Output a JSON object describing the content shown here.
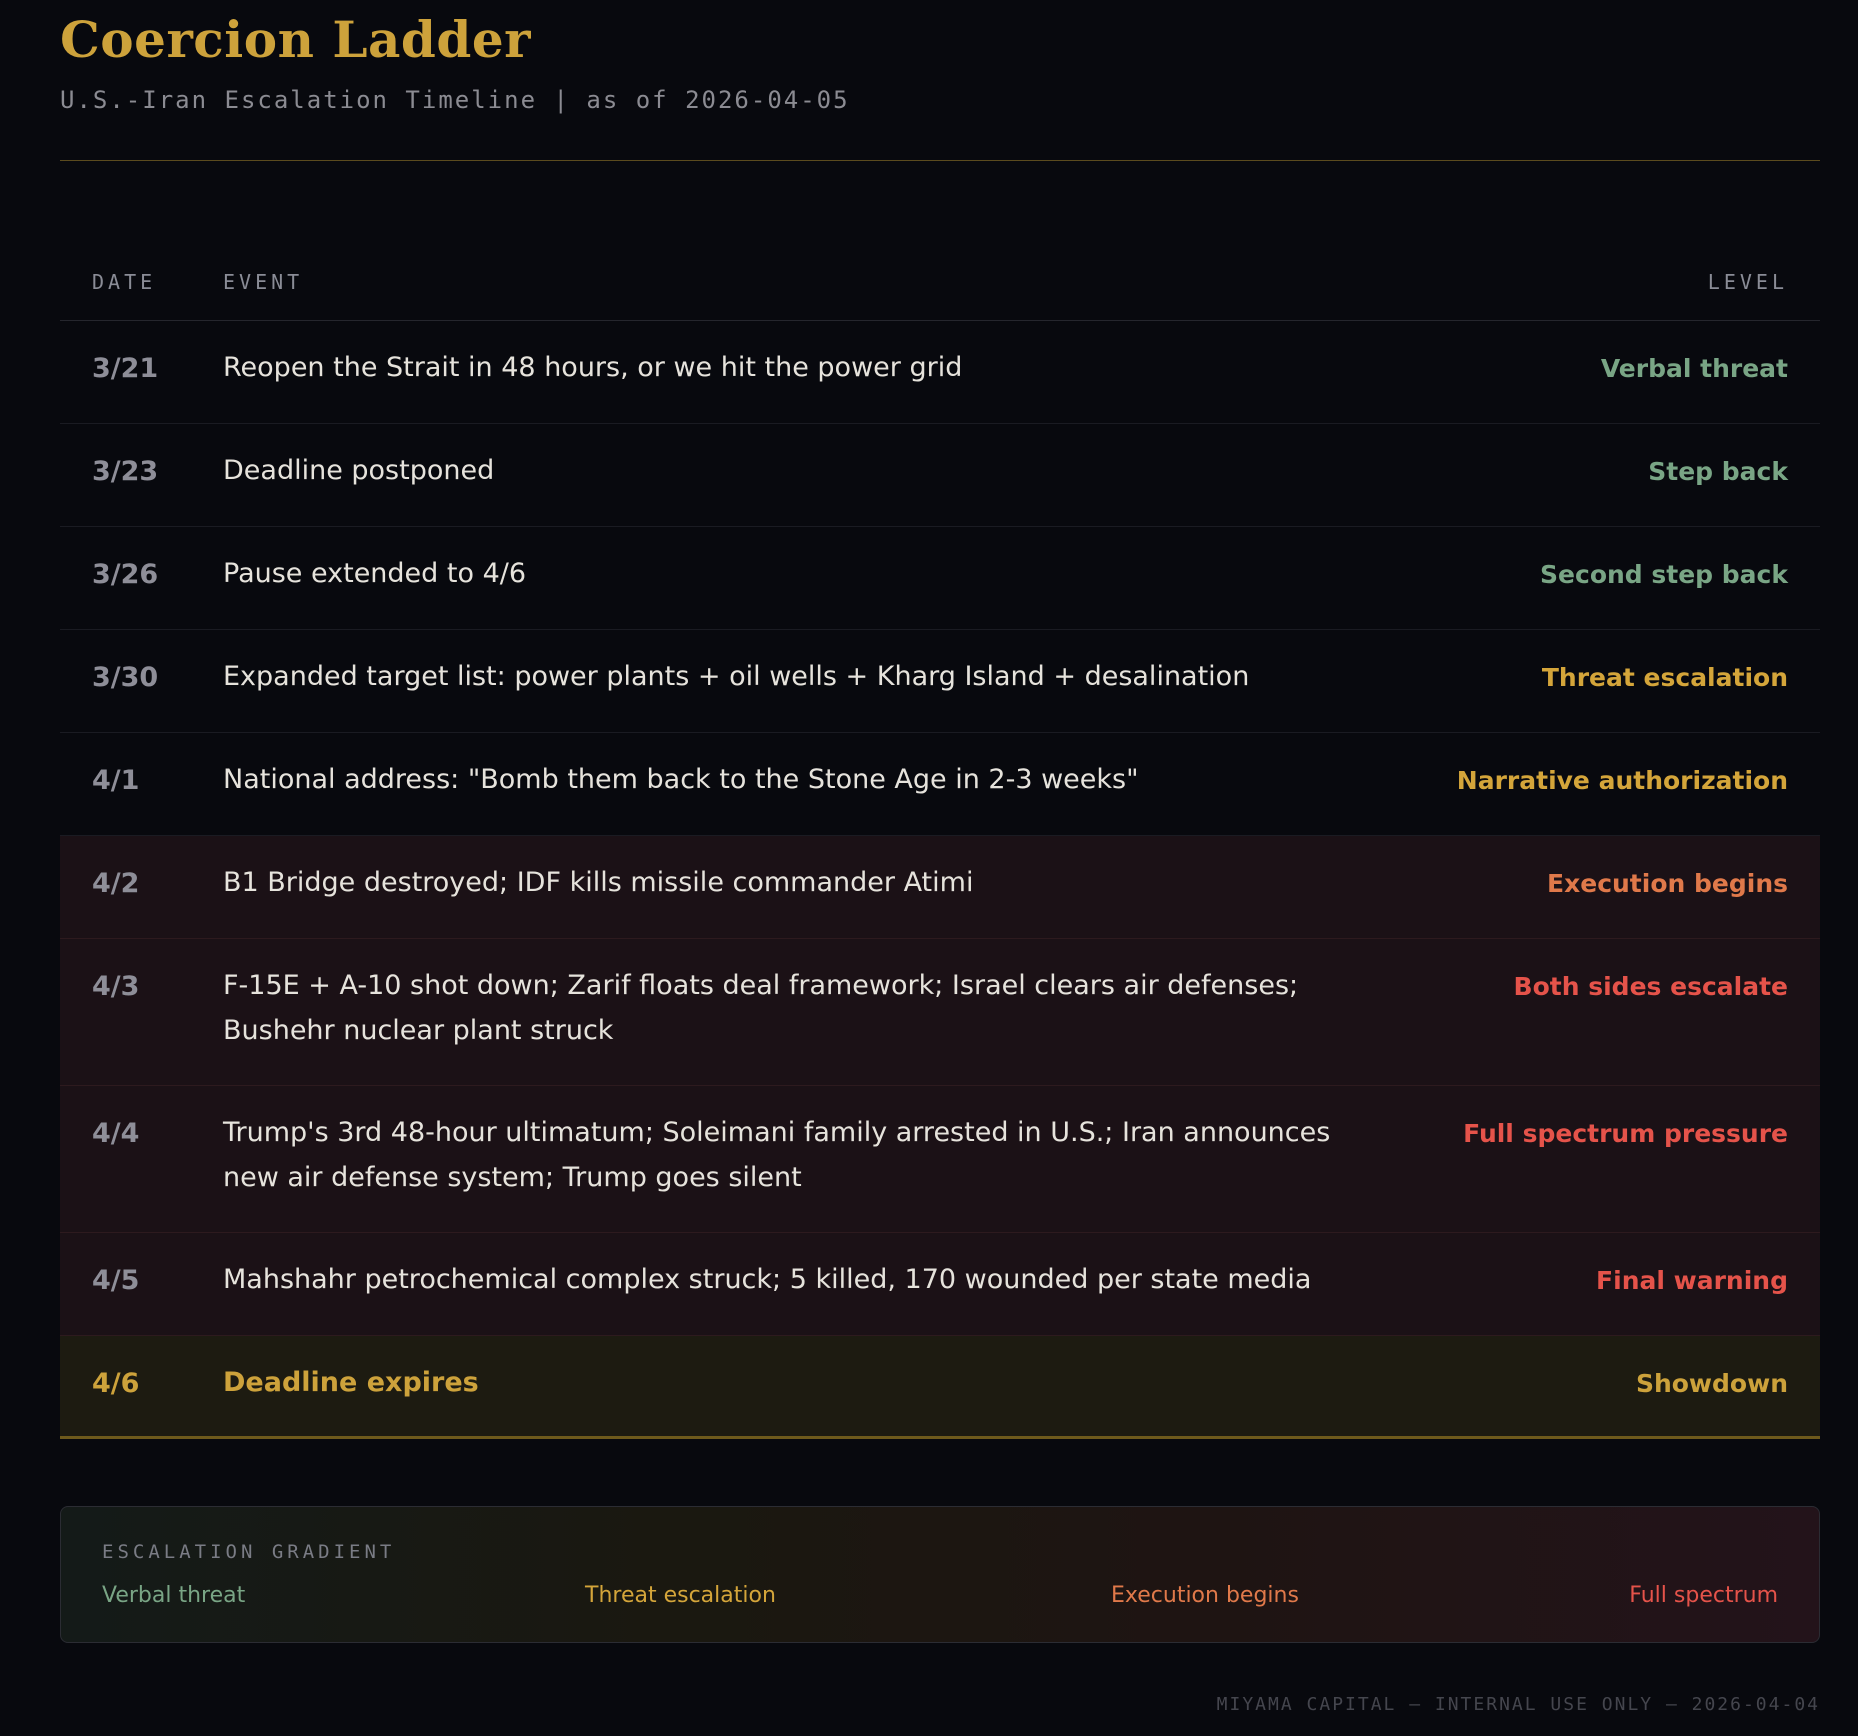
{
  "header": {
    "title": "Coercion Ladder",
    "subtitle": "U.S.-Iran Escalation Timeline | as of 2026-04-05"
  },
  "table": {
    "columns": {
      "date": "DATE",
      "event": "EVENT",
      "level": "LEVEL"
    },
    "rows": [
      {
        "date": "3/21",
        "event": "Reopen the Strait in 48 hours, or we hit the power grid",
        "level": "Verbal threat",
        "level_color": "#79a585"
      },
      {
        "date": "3/23",
        "event": "Deadline postponed",
        "level": "Step back",
        "level_color": "#79a585"
      },
      {
        "date": "3/26",
        "event": "Pause extended to 4/6",
        "level": "Second step back",
        "level_color": "#79a585"
      },
      {
        "date": "3/30",
        "event": "Expanded target list: power plants + oil wells + Kharg Island + desalination",
        "level": "Threat escalation",
        "level_color": "#d4a53a"
      },
      {
        "date": "4/1",
        "event": "National address: \"Bomb them back to the Stone Age in 2-3 weeks\"",
        "level": "Narrative authorization",
        "level_color": "#d4a53a"
      },
      {
        "date": "4/2",
        "event": "B1 Bridge destroyed; IDF kills missile commander Atimi",
        "level": "Execution begins",
        "level_color": "#e0794a"
      },
      {
        "date": "4/3",
        "event": "F-15E + A-10 shot down; Zarif floats deal framework; Israel clears air defenses; Bushehr nuclear plant struck",
        "level": "Both sides escalate",
        "level_color": "#e5534a"
      },
      {
        "date": "4/4",
        "event": "Trump's 3rd 48-hour ultimatum; Soleimani family arrested in U.S.; Iran announces new air defense system; Trump goes silent",
        "level": "Full spectrum pressure",
        "level_color": "#e5534a"
      },
      {
        "date": "4/5",
        "event": "Mahshahr petrochemical complex struck; 5 killed, 170 wounded per state media",
        "level": "Final warning",
        "level_color": "#e5534a"
      },
      {
        "date": "4/6",
        "event": "Deadline expires",
        "level": "Showdown",
        "level_color": "#cda23b"
      }
    ]
  },
  "gradient": {
    "title": "ESCALATION GRADIENT",
    "stops": [
      {
        "label": "Verbal threat",
        "color": "#79a585"
      },
      {
        "label": "Threat escalation",
        "color": "#d4a53a"
      },
      {
        "label": "Execution begins",
        "color": "#e0794a"
      },
      {
        "label": "Full spectrum",
        "color": "#e5534a"
      }
    ]
  },
  "footer": {
    "text": "MIYAMA CAPITAL — INTERNAL USE ONLY — 2026-04-04"
  }
}
